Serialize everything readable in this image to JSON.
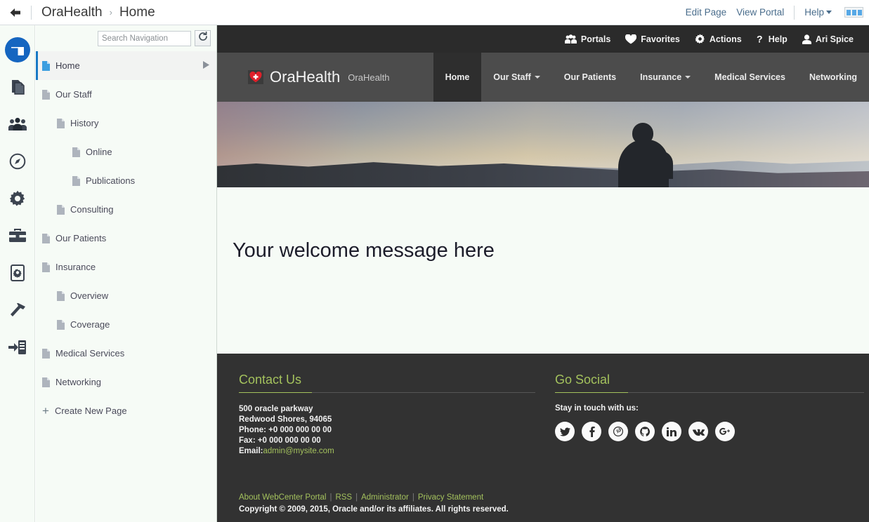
{
  "topbar": {
    "back_icon": "back-arrow-icon",
    "breadcrumb": {
      "portal": "OraHealth",
      "separator": "›",
      "page": "Home"
    },
    "edit_page": "Edit Page",
    "view_portal": "View Portal",
    "help": "Help",
    "panels_toggle_icon": "panels-toggle-icon"
  },
  "rail": {
    "items": [
      {
        "name": "pages-icon",
        "active": true
      },
      {
        "name": "documents-icon",
        "active": false
      },
      {
        "name": "people-icon",
        "active": false
      },
      {
        "name": "compass-icon",
        "active": false
      },
      {
        "name": "gear-icon",
        "active": false
      },
      {
        "name": "toolbox-icon",
        "active": false
      },
      {
        "name": "device-settings-icon",
        "active": false
      },
      {
        "name": "hammer-icon",
        "active": false
      },
      {
        "name": "import-server-icon",
        "active": false
      }
    ]
  },
  "nav": {
    "search_placeholder": "Search Navigation",
    "search_value": "",
    "refresh_icon": "refresh-icon",
    "items": [
      {
        "label": "Home",
        "level": 0,
        "selected": true,
        "has_arrow": true
      },
      {
        "label": "Our Staff",
        "level": 0,
        "selected": false,
        "has_arrow": false
      },
      {
        "label": "History",
        "level": 1,
        "selected": false,
        "has_arrow": false
      },
      {
        "label": "Online",
        "level": 2,
        "selected": false,
        "has_arrow": false
      },
      {
        "label": "Publications",
        "level": 2,
        "selected": false,
        "has_arrow": false
      },
      {
        "label": "Consulting",
        "level": 1,
        "selected": false,
        "has_arrow": false
      },
      {
        "label": "Our Patients",
        "level": 0,
        "selected": false,
        "has_arrow": false
      },
      {
        "label": "Insurance",
        "level": 0,
        "selected": false,
        "has_arrow": false
      },
      {
        "label": "Overview",
        "level": 1,
        "selected": false,
        "has_arrow": false
      },
      {
        "label": "Coverage",
        "level": 1,
        "selected": false,
        "has_arrow": false
      },
      {
        "label": "Medical Services",
        "level": 0,
        "selected": false,
        "has_arrow": false
      },
      {
        "label": "Networking",
        "level": 0,
        "selected": false,
        "has_arrow": false
      }
    ],
    "create_new_page": "Create New Page"
  },
  "portal": {
    "utility": [
      {
        "label": "Portals",
        "icon": "portals-icon"
      },
      {
        "label": "Favorites",
        "icon": "heart-icon"
      },
      {
        "label": "Actions",
        "icon": "gear-icon"
      },
      {
        "label": "Help",
        "icon": "question-icon"
      },
      {
        "label": "Ari Spice",
        "icon": "user-icon"
      }
    ],
    "brand": {
      "logo_icon": "heart-cross-logo-icon",
      "name": "OraHealth",
      "subtitle": "OraHealth"
    },
    "menu": [
      {
        "label": "Home",
        "active": true,
        "dropdown": false
      },
      {
        "label": "Our Staff",
        "active": false,
        "dropdown": true
      },
      {
        "label": "Our Patients",
        "active": false,
        "dropdown": false
      },
      {
        "label": "Insurance",
        "active": false,
        "dropdown": true
      },
      {
        "label": "Medical Services",
        "active": false,
        "dropdown": false
      },
      {
        "label": "Networking",
        "active": false,
        "dropdown": false
      }
    ],
    "hero_alt": "silhouette-of-person-overlooking-misty-hills",
    "welcome_message": "Your welcome message here"
  },
  "footer": {
    "contact": {
      "title": "Contact Us",
      "lines": [
        "500 oracle parkway",
        "Redwood Shores, 94065",
        "Phone: +0 000 000 00 00",
        "Fax: +0 000 000 00 00"
      ],
      "email_label": "Email:",
      "email": "admin@mysite.com"
    },
    "social": {
      "title": "Go Social",
      "tagline": "Stay in touch with us:",
      "icons": [
        {
          "name": "twitter-icon",
          "glyph": "ᵗ"
        },
        {
          "name": "facebook-icon",
          "glyph": "f"
        },
        {
          "name": "pinterest-icon",
          "glyph": "℘"
        },
        {
          "name": "github-icon",
          "glyph": "Ω"
        },
        {
          "name": "linkedin-icon",
          "glyph": "in"
        },
        {
          "name": "vk-icon",
          "glyph": "vk"
        },
        {
          "name": "googleplus-icon",
          "glyph": "g+"
        }
      ]
    },
    "links": [
      "About WebCenter Portal",
      "RSS",
      "Administrator",
      "Privacy Statement"
    ],
    "copyright": "Copyright © 2009, 2015, Oracle and/or its affiliates. All rights reserved."
  },
  "colors": {
    "accent_blue": "#1565c0",
    "link_blue": "#4a6d8c",
    "footer_bg": "#323232",
    "footer_green": "#a4c25d",
    "page_bg": "#f6fbf6",
    "header_gray": "#4c4c4c",
    "utility_dark": "#2b2b2b"
  }
}
